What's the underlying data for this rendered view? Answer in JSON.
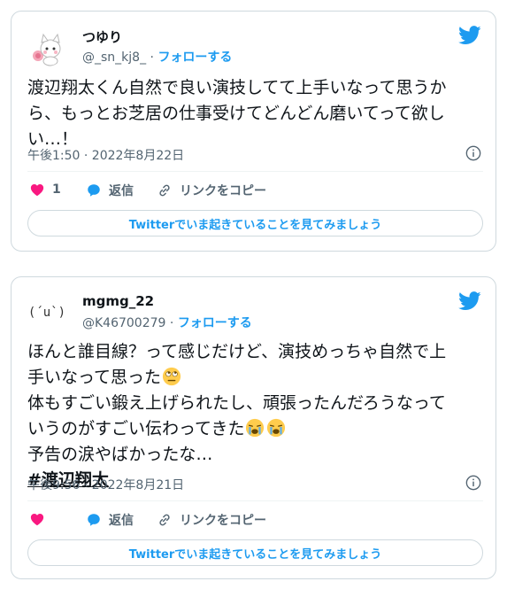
{
  "tweets": [
    {
      "name": "つゆり",
      "handle": "@_sn_kj8_",
      "dot": "·",
      "follow": "フォローする",
      "text_lines": [
        "渡辺翔太くん自然で良い演技してて上手いなって思うか",
        "ら、もっとお芝居の仕事受けてどんどん磨いてって欲し",
        "い…！"
      ],
      "timestamp": "午後1:50 · 2022年8月22日",
      "like_count": "1",
      "reply_label": "返信",
      "link_label": "リンクをコピー",
      "cta": "Twitterでいま起きていることを見てみましょう",
      "avatar": "cat-avatar"
    },
    {
      "name": "mgmg_22",
      "handle": "@K46700279",
      "dot": "·",
      "follow": "フォローする",
      "avatar_text": "(´u`)",
      "line1": "ほんと誰目線？って感じだけど、演技めっちゃ自然で上",
      "line2": "手いなって思った",
      "line3": "体もすごい鍛え上げられたし、頑張ったんだろうなって",
      "line4": "いうのがすごい伝わってきた",
      "line5": "予告の涙やばかったな…",
      "hashtag": "#渡辺翔太",
      "timestamp": "午後9:56 · 2022年8月21日",
      "like_count": "",
      "reply_label": "返信",
      "link_label": "リンクをコピー",
      "cta": "Twitterでいま起きていることを見てみましょう"
    }
  ],
  "colors": {
    "accent": "#1d9bf0",
    "like": "#f91880",
    "muted": "#536471"
  },
  "icons": [
    "twitter-bird-icon",
    "info-icon",
    "heart-icon",
    "reply-bubble-icon",
    "link-icon",
    "rolling-eyes-emoji",
    "crying-emoji"
  ]
}
